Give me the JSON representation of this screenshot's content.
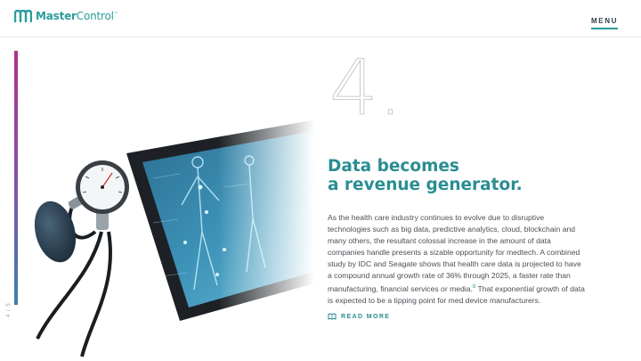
{
  "header": {
    "logo_bold": "Master",
    "logo_light": "Control",
    "logo_mark": "™",
    "menu_label": "MENU"
  },
  "sidebar": {
    "pager": "4 / 5"
  },
  "article": {
    "number": "4.",
    "headline_line1": "Data becomes",
    "headline_line2": "a revenue generator.",
    "body_pre": "As the health care industry continues to evolve due to disruptive technologies such as big data, predictive analytics, cloud, blockchain and many others, the resultant colossal increase in the amount of data companies handle presents a sizable opportunity for medtech. A combined study by IDC and Seagate shows that health care data is projected to have a compound annual growth rate of 36% through 2025, a faster rate than manufacturing, financial services or media.",
    "footnote": "8",
    "body_post": " That exponential growth of data is expected to be a tipping point for med device manufacturers.",
    "read_more": "READ MORE"
  },
  "colors": {
    "accent": "#2a9d9c",
    "headline": "#2a8e92",
    "bar_top": "#b0318b",
    "bar_bottom": "#3b7fb0"
  },
  "icons": {
    "logo": "mastercontrol-logo-icon",
    "read_more": "book-icon"
  }
}
